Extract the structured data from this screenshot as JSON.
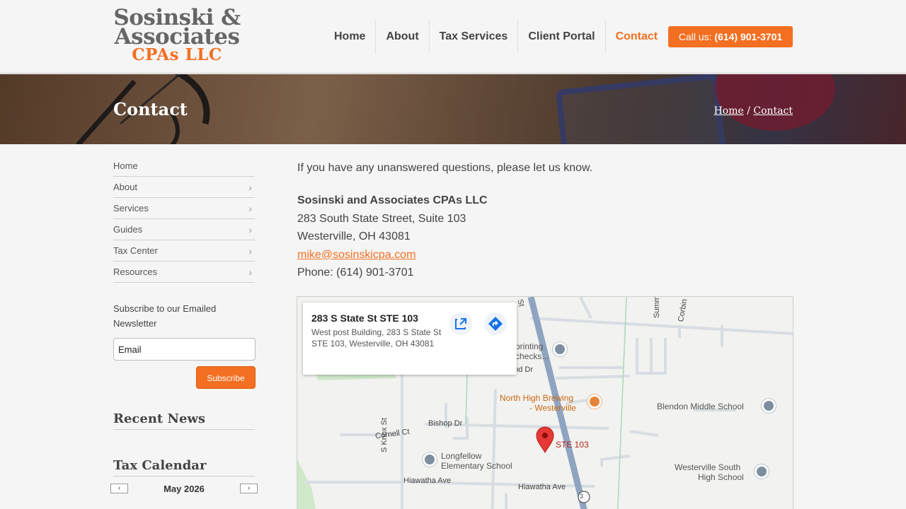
{
  "header": {
    "logo": {
      "line1": "Sosinski &",
      "line2": "Associates",
      "line3": "CPAs LLC"
    },
    "nav": [
      {
        "label": "Home",
        "active": false
      },
      {
        "label": "About",
        "active": false
      },
      {
        "label": "Tax Services",
        "active": false
      },
      {
        "label": "Client Portal",
        "active": false
      },
      {
        "label": "Contact",
        "active": true
      }
    ],
    "call": {
      "prefix": "Call us:",
      "phone": "(614) 901-3701"
    }
  },
  "banner": {
    "title": "Contact",
    "breadcrumb": {
      "home": "Home",
      "sep": "/",
      "current": "Contact"
    }
  },
  "sidebar": {
    "menu": [
      {
        "label": "Home",
        "has_submenu": false
      },
      {
        "label": "About",
        "has_submenu": true
      },
      {
        "label": "Services",
        "has_submenu": true
      },
      {
        "label": "Guides",
        "has_submenu": true
      },
      {
        "label": "Tax Center",
        "has_submenu": true
      },
      {
        "label": "Resources",
        "has_submenu": true
      }
    ],
    "newsletter": {
      "label": "Subscribe to our Emailed Newsletter",
      "email_value": "Email",
      "button": "Subscribe"
    },
    "recent_news": "Recent News",
    "tax_calendar": {
      "heading": "Tax Calendar",
      "month": "May 2026",
      "prev": "‹",
      "next": "›"
    }
  },
  "main": {
    "intro": "If you have any unanswered questions, please let us know.",
    "company": "Sosinski and Associates CPAs LLC",
    "street": "283 South State Street, Suite 103",
    "city": "Westerville, OH 43081",
    "email": "mike@sosinskicpa.com",
    "phone": "Phone: (614) 901-3701"
  },
  "map": {
    "card": {
      "title": "283 S State St STE 103",
      "address": "West post Building, 283 S State St STE 103, Westerville, OH 43081",
      "open_icon": "open-in-new-icon",
      "directions_icon": "directions-icon"
    },
    "labels": {
      "printing": "printing",
      "checks": "checks...",
      "wood_dr": "ood Dr",
      "brewing1": "North High Brewing",
      "brewing2": "- Westerville",
      "blendon": "Blendon Middle School",
      "ste": "STE 103",
      "cornell": "Cornell Ct",
      "bishop": "Bishop Dr",
      "knox": "S Knox St",
      "longfellow1": "Longfellow",
      "longfellow2": "Elementary School",
      "wsouth1": "Westerville South",
      "wsouth2": "High School",
      "hiawatha1": "Hiawatha Ave",
      "hiawatha2": "Hiawatha Ave",
      "state_st": "St",
      "summ": "Summ",
      "corbin": "Corbin",
      "route": "3"
    },
    "colors": {
      "road": "#8fa4c0",
      "street": "#d8dde3",
      "pin": "#e53935"
    }
  }
}
